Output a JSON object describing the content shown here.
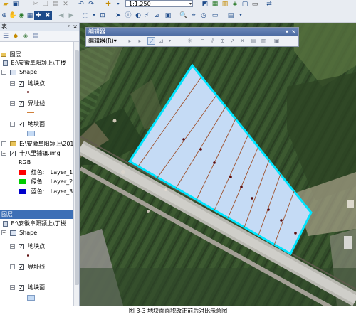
{
  "toolbar": {
    "scale_value": "1:1,250"
  },
  "toc": {
    "title": "表",
    "pin_glyph": "ᵖ",
    "close_glyph": "×",
    "group1_label": "图层",
    "path1": "E:\\安徽阜阳颍上\\丁楼",
    "shape1_label": "Shape",
    "layer_point": "地块点",
    "layer_line": "界址线",
    "layer_polygon": "地块面",
    "path2": "E:\\安徽阜阳颍上\\2014",
    "raster_label": "十八里铺镇.img",
    "rgb_label": "RGB",
    "band_red": "红色:",
    "band_red_layer": "Layer_1",
    "band_green": "绿色:",
    "band_green_layer": "Layer_2",
    "band_blue": "蓝色:",
    "band_blue_layer": "Layer_3",
    "group2_label": "图层",
    "path3": "E:\\安徽阜阳颍上\\丁楼",
    "shape2_label": "Shape",
    "layer_point2": "地块点",
    "layer_line2": "界址线",
    "layer_polygon2": "地块面"
  },
  "editor": {
    "title": "编辑器",
    "menu_label": "编辑器(R)▾",
    "dropdown_glyph": "▾",
    "close_glyph": "×"
  },
  "colors": {
    "polygon_fill": "#c5dbf5",
    "polygon_outline": "#00e5ff",
    "boundary_line": "#a0522d",
    "point": "#5a0a0a",
    "band_red": "#ff0000",
    "band_green": "#00cc00",
    "band_blue": "#0000cc"
  },
  "caption": "图 3-3    地块面面积改正前后对比示意图"
}
